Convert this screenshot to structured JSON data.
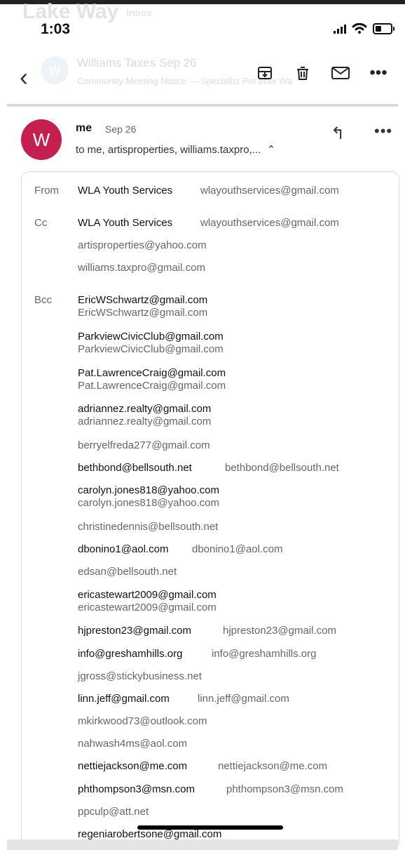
{
  "status": {
    "time": "1:03"
  },
  "ghost": {
    "title": "Lake Way",
    "label": "Inbox",
    "avatar": "W",
    "subject": "Williams Taxes",
    "date": "Sep 26",
    "preview": "Community Meeting Notice — Specialist Pet after Wa"
  },
  "header": {
    "actions": [
      "archive-icon",
      "trash-icon",
      "mail-icon",
      "more-icon"
    ]
  },
  "message": {
    "avatar": "W",
    "sender": "me",
    "date": "Sep 26",
    "to": "to me, artisproperties, williams.taxpro,...",
    "from": {
      "label": "From",
      "name": "WLA Youth Services",
      "email": "wlayouthservices@gmail.com"
    },
    "cc": {
      "label": "Cc",
      "name": "WLA Youth Services",
      "email": "wlayouthservices@gmail.com",
      "others": [
        "artisproperties@yahoo.com",
        "williams.taxpro@gmail.com"
      ]
    },
    "bcc": {
      "label": "Bcc",
      "items": [
        [
          "EricWSchwartz@gmail.com",
          "EricWSchwartz@gmail.com",
          "stack"
        ],
        [
          "ParkviewCivicClub@gmail.com",
          "ParkviewCivicClub@gmail.com",
          "stack"
        ],
        [
          "Pat.LawrenceCraig@gmail.com",
          "Pat.LawrenceCraig@gmail.com",
          "stack"
        ],
        [
          "adriannez.realty@gmail.com",
          "adriannez.realty@gmail.com",
          "stack"
        ],
        [
          "",
          "berryelfreda277@gmail.com",
          "single"
        ],
        [
          "bethbond@bellsouth.net",
          "bethbond@bellsouth.net",
          "inline"
        ],
        [
          "carolyn.jones818@yahoo.com",
          "carolyn.jones818@yahoo.com",
          "stack"
        ],
        [
          "",
          "christinedennis@bellsouth.net",
          "single"
        ],
        [
          "dbonino1@aol.com",
          "dbonino1@aol.com",
          "inline"
        ],
        [
          "",
          "edsan@bellsouth.net",
          "single"
        ],
        [
          "ericastewart2009@gmail.com",
          "ericastewart2009@gmail.com",
          "stack"
        ],
        [
          "hjpreston23@gmail.com",
          "hjpreston23@gmail.com",
          "inline"
        ],
        [
          "info@greshamhills.org",
          "info@greshamhills.org",
          "inline"
        ],
        [
          "",
          "jgross@stickybusiness.net",
          "single"
        ],
        [
          "linn.jeff@gmail.com",
          "linn.jeff@gmail.com",
          "inline"
        ],
        [
          "",
          "mkirkwood73@outlook.com",
          "single"
        ],
        [
          "",
          "nahwash4ms@aol.com",
          "single"
        ],
        [
          "nettiejackson@me.com",
          "nettiejackson@me.com",
          "inline"
        ],
        [
          "phthompson3@msn.com",
          "phthompson3@msn.com",
          "inline"
        ],
        [
          "",
          "ppculp@att.net",
          "single"
        ],
        [
          "regeniarobertsone@gmail.com",
          "",
          "single-main"
        ]
      ]
    }
  }
}
